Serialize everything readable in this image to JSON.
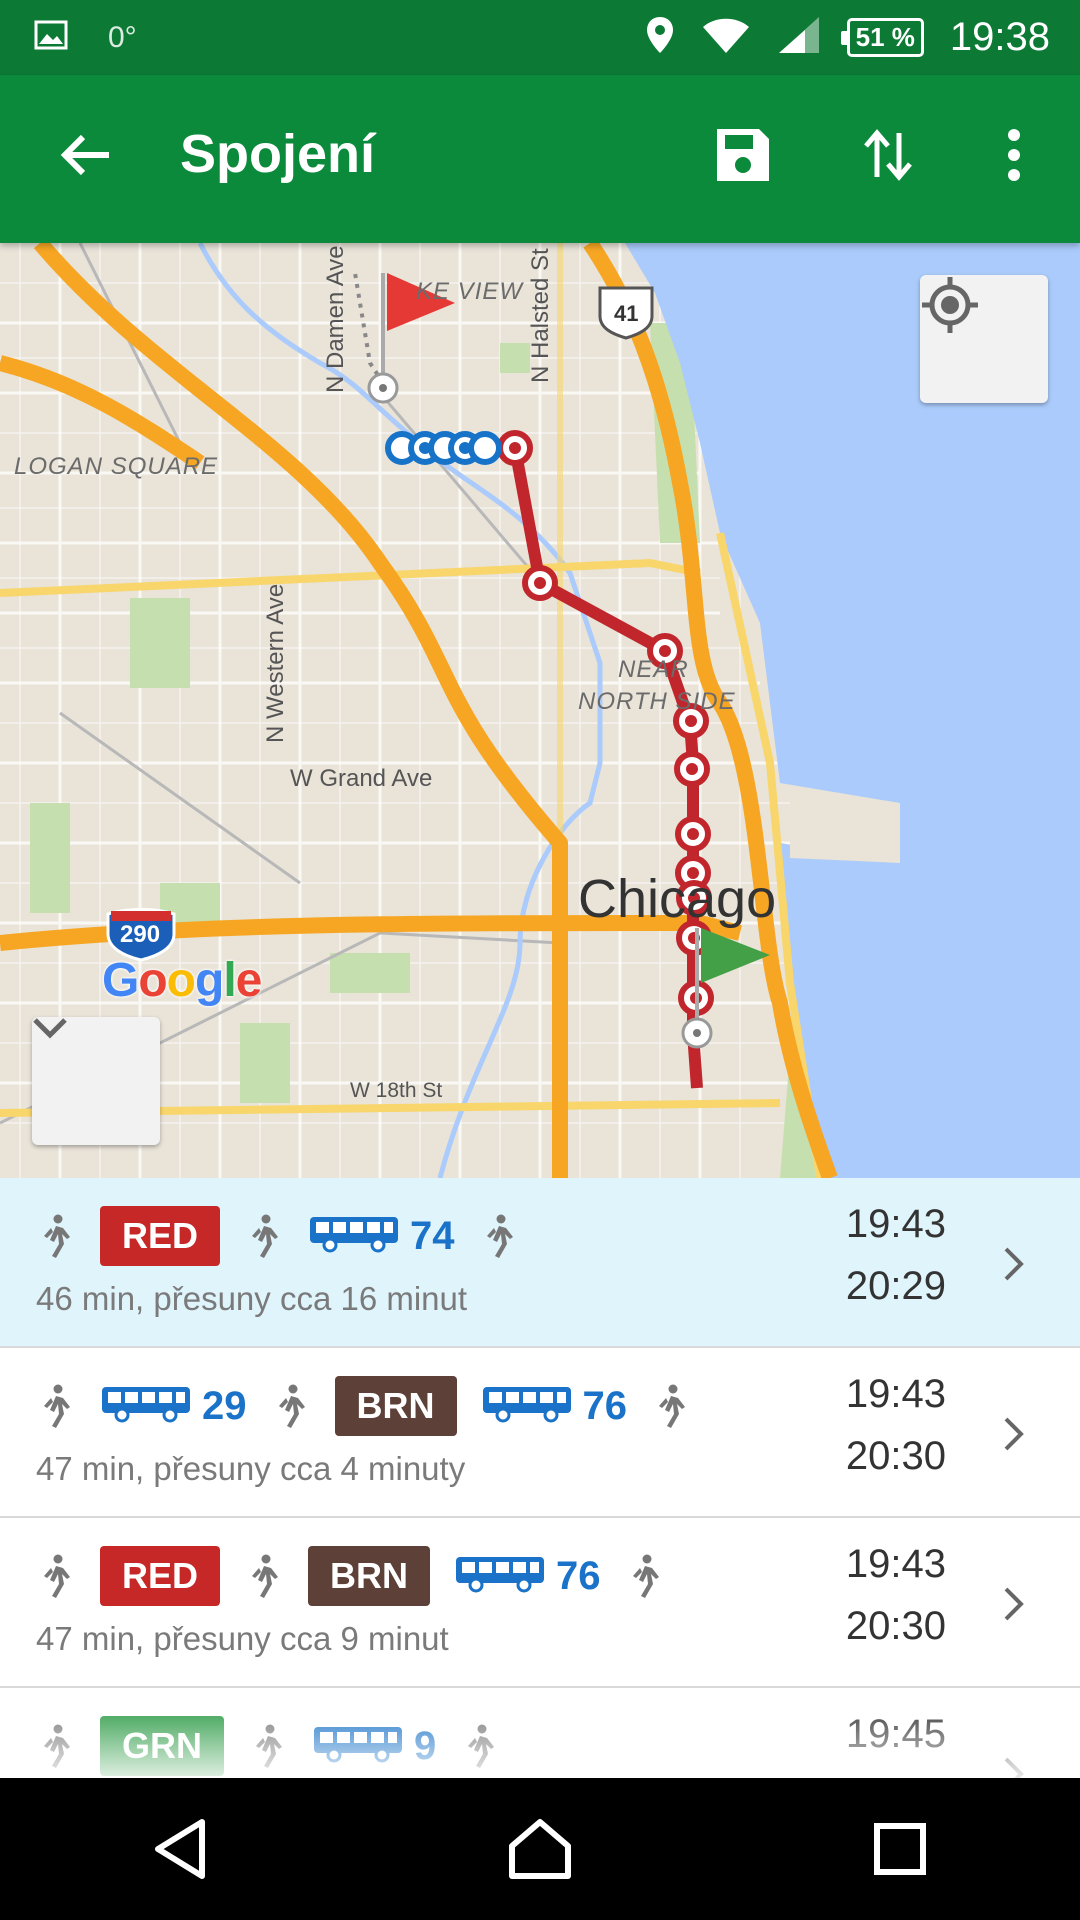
{
  "status_bar": {
    "temperature": "0°",
    "battery": "51 %",
    "time": "19:38",
    "icons": [
      "image-icon",
      "location-pin-icon",
      "wifi-icon",
      "signal-icon",
      "battery-icon"
    ]
  },
  "app_bar": {
    "title": "Spojení",
    "icons": [
      "back-arrow-icon",
      "save-icon",
      "swap-icon",
      "overflow-menu-icon"
    ]
  },
  "map": {
    "labels": {
      "lake_view": "KE VIEW",
      "damen": "N Damen Ave",
      "halsted": "N Halsted St",
      "logan_square": "LOGAN SQUARE",
      "western": "N Western Ave",
      "near_north_1": "NEAR",
      "near_north_2": "NORTH SIDE",
      "grand": "W Grand Ave",
      "chicago": "Chicago",
      "w18th": "W 18th St",
      "shield_41": "41",
      "shield_290": "290"
    },
    "google_logo": [
      "G",
      "o",
      "o",
      "g",
      "l",
      "e"
    ],
    "colors": {
      "water": "#aacbfb",
      "highway": "#f6a623",
      "arterial": "#f8d66b",
      "park": "#c6dfae",
      "route": "#c0262c",
      "walk_marker": "#1673c8",
      "start_flag": "#e53935",
      "end_flag": "#43a047"
    }
  },
  "connections": [
    {
      "segments": [
        {
          "type": "walk"
        },
        {
          "type": "line",
          "label": "RED",
          "color": "#c62828"
        },
        {
          "type": "walk"
        },
        {
          "type": "bus",
          "label": "74"
        },
        {
          "type": "walk"
        }
      ],
      "description": "46 min, přesuny cca 16 minut",
      "departure": "19:43",
      "arrival": "20:29",
      "selected": true
    },
    {
      "segments": [
        {
          "type": "walk"
        },
        {
          "type": "bus",
          "label": "29"
        },
        {
          "type": "walk"
        },
        {
          "type": "line",
          "label": "BRN",
          "color": "#5d4037"
        },
        {
          "type": "bus",
          "label": "76"
        },
        {
          "type": "walk"
        }
      ],
      "description": "47 min, přesuny cca 4 minuty",
      "departure": "19:43",
      "arrival": "20:30",
      "selected": false
    },
    {
      "segments": [
        {
          "type": "walk"
        },
        {
          "type": "line",
          "label": "RED",
          "color": "#c62828"
        },
        {
          "type": "walk"
        },
        {
          "type": "line",
          "label": "BRN",
          "color": "#5d4037"
        },
        {
          "type": "bus",
          "label": "76"
        },
        {
          "type": "walk"
        }
      ],
      "description": "47 min, přesuny cca 9 minut",
      "departure": "19:43",
      "arrival": "20:30",
      "selected": false
    },
    {
      "segments": [
        {
          "type": "walk"
        },
        {
          "type": "line",
          "label": "GRN",
          "color": "#2e9b47"
        },
        {
          "type": "walk"
        },
        {
          "type": "bus",
          "label": "9"
        },
        {
          "type": "walk"
        }
      ],
      "description": "",
      "departure": "19:45",
      "arrival": "",
      "selected": false
    }
  ],
  "nav_bar": {
    "icons": [
      "back-triangle-icon",
      "home-icon",
      "recents-icon"
    ]
  }
}
